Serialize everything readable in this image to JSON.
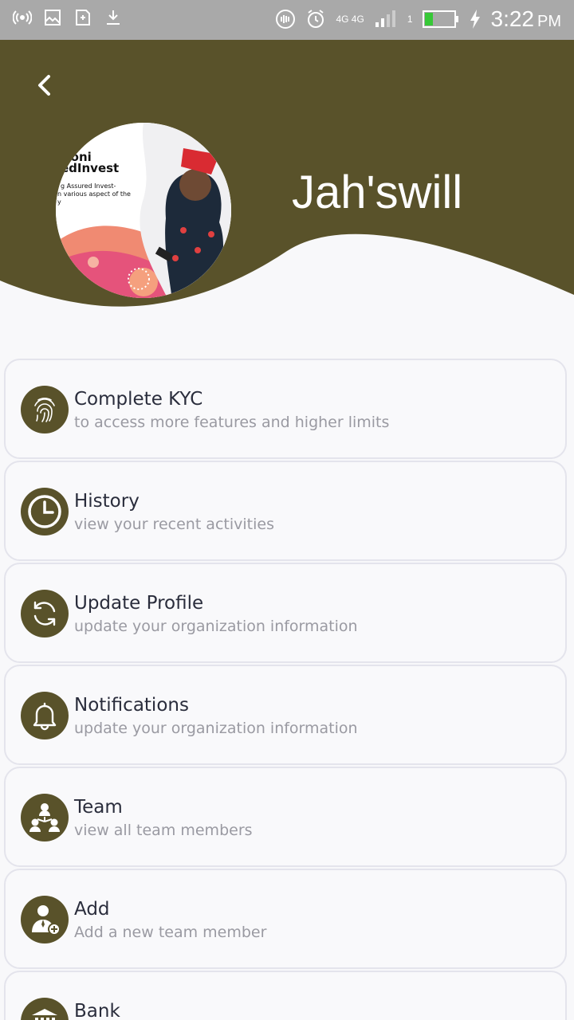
{
  "status_bar": {
    "time": "3:22",
    "ampm": "PM",
    "network_label": "4G 4G",
    "sim_slot": "1",
    "colors": {
      "bar": "#a9a9a9",
      "battery_level": "#37c837"
    }
  },
  "header": {
    "name": "Jah'swill",
    "colors": {
      "brand": "#59522a",
      "background": "#f8f8fa"
    },
    "avatar_text": {
      "line1": "noni",
      "line2": "edInvest",
      "line3": "g Assured Invest-",
      "line4": "n various aspect of the",
      "line5": "y"
    }
  },
  "menu": {
    "items": [
      {
        "title": "Complete KYC",
        "subtitle": "to access more features and higher limits",
        "icon": "fingerprint-icon"
      },
      {
        "title": "History",
        "subtitle": "view your recent activities",
        "icon": "clock-icon"
      },
      {
        "title": "Update Profile",
        "subtitle": "update your organization information",
        "icon": "refresh-icon"
      },
      {
        "title": "Notifications",
        "subtitle": "update your organization information",
        "icon": "bell-icon"
      },
      {
        "title": "Team",
        "subtitle": "view all team members",
        "icon": "team-icon"
      },
      {
        "title": "Add",
        "subtitle": "Add a new team member",
        "icon": "add-user-icon"
      },
      {
        "title": "Bank",
        "subtitle": "",
        "icon": "bank-icon"
      }
    ]
  }
}
